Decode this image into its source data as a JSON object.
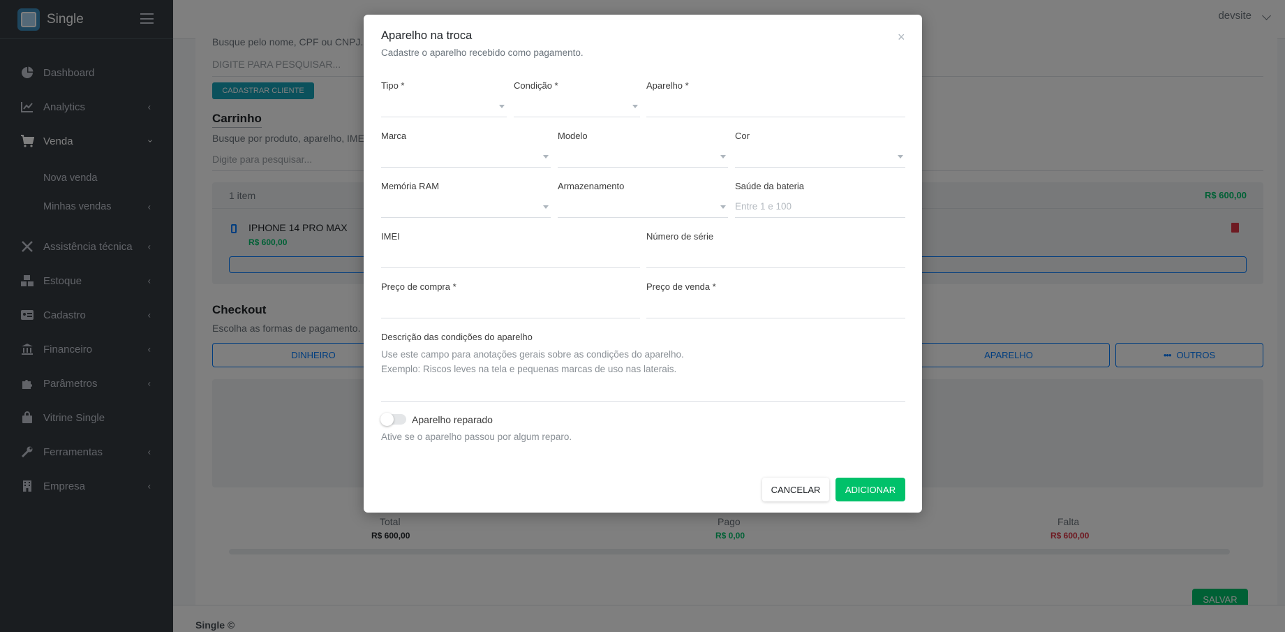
{
  "sidebar": {
    "brand": "Single",
    "items": [
      {
        "label": "Dashboard",
        "icon": "dashboard-icon"
      },
      {
        "label": "Analytics",
        "icon": "chart-icon"
      },
      {
        "label": "Venda",
        "icon": "cart-icon"
      },
      {
        "label": "Assistência técnica",
        "icon": "tools-icon"
      },
      {
        "label": "Estoque",
        "icon": "boxes-icon"
      },
      {
        "label": "Cadastro",
        "icon": "id-card-icon"
      },
      {
        "label": "Financeiro",
        "icon": "bank-icon"
      },
      {
        "label": "Parâmetros",
        "icon": "puzzle-icon"
      },
      {
        "label": "Vitrine Single",
        "icon": "shopping-bag-icon"
      },
      {
        "label": "Ferramentas",
        "icon": "wrench-icon"
      },
      {
        "label": "Empresa",
        "icon": "building-icon"
      }
    ],
    "sub_items": [
      {
        "label": "Nova venda"
      },
      {
        "label": "Minhas vendas"
      }
    ]
  },
  "topbar": {
    "user": "devsite"
  },
  "background": {
    "client_hint": "Busque pelo nome, CPF ou CNPJ.",
    "client_placeholder": "DIGITE PARA PESQUISAR...",
    "register_client": "CADASTRAR CLIENTE",
    "cart_title": "Carrinho",
    "cart_hint": "Busque por produto, aparelho, IMEI",
    "cart_placeholder": "Digite para pesquisar...",
    "cart_count": "1 item",
    "cart_total": "R$ 600,00",
    "product_name": "IPHONE 14 PRO MAX",
    "product_price": "R$ 600,00",
    "checkout_title": "Checkout",
    "checkout_hint": "Escolha as formas de pagamento.",
    "pay_cash": "DINHEIRO",
    "pay_device": "APARELHO",
    "pay_other": "OUTROS",
    "total_label": "Total",
    "total_value": "R$ 600,00",
    "paid_label": "Pago",
    "paid_value": "R$ 0,00",
    "missing_label": "Falta",
    "missing_value": "R$ 600,00",
    "save": "SALVAR",
    "footer": "Single ©"
  },
  "modal": {
    "title": "Aparelho na troca",
    "subtitle": "Cadastre o aparelho recebido como pagamento.",
    "tipo_label": "Tipo *",
    "condicao_label": "Condição *",
    "aparelho_label": "Aparelho *",
    "marca_label": "Marca",
    "modelo_label": "Modelo",
    "cor_label": "Cor",
    "ram_label": "Memória RAM",
    "armazenamento_label": "Armazenamento",
    "bateria_label": "Saúde da bateria",
    "bateria_placeholder": "Entre 1 e 100",
    "imei_label": "IMEI",
    "serie_label": "Número de série",
    "preco_compra_label": "Preço de compra *",
    "preco_venda_label": "Preço de venda *",
    "descricao_label": "Descrição das condições do aparelho",
    "descricao_placeholder_1": "Use este campo para anotações gerais sobre as condições do aparelho.",
    "descricao_placeholder_2": "Exemplo: Riscos leves na tela e pequenas marcas de uso nas laterais.",
    "reparado_label": "Aparelho reparado",
    "reparado_hint": "Ative se o aparelho passou por algum reparo.",
    "cancel": "CANCELAR",
    "add": "ADICIONAR"
  },
  "colors": {
    "sidebar": "#343a40",
    "primary": "#007bff",
    "success": "#00c16a",
    "danger": "#dc3545",
    "info": "#17a2b8"
  }
}
